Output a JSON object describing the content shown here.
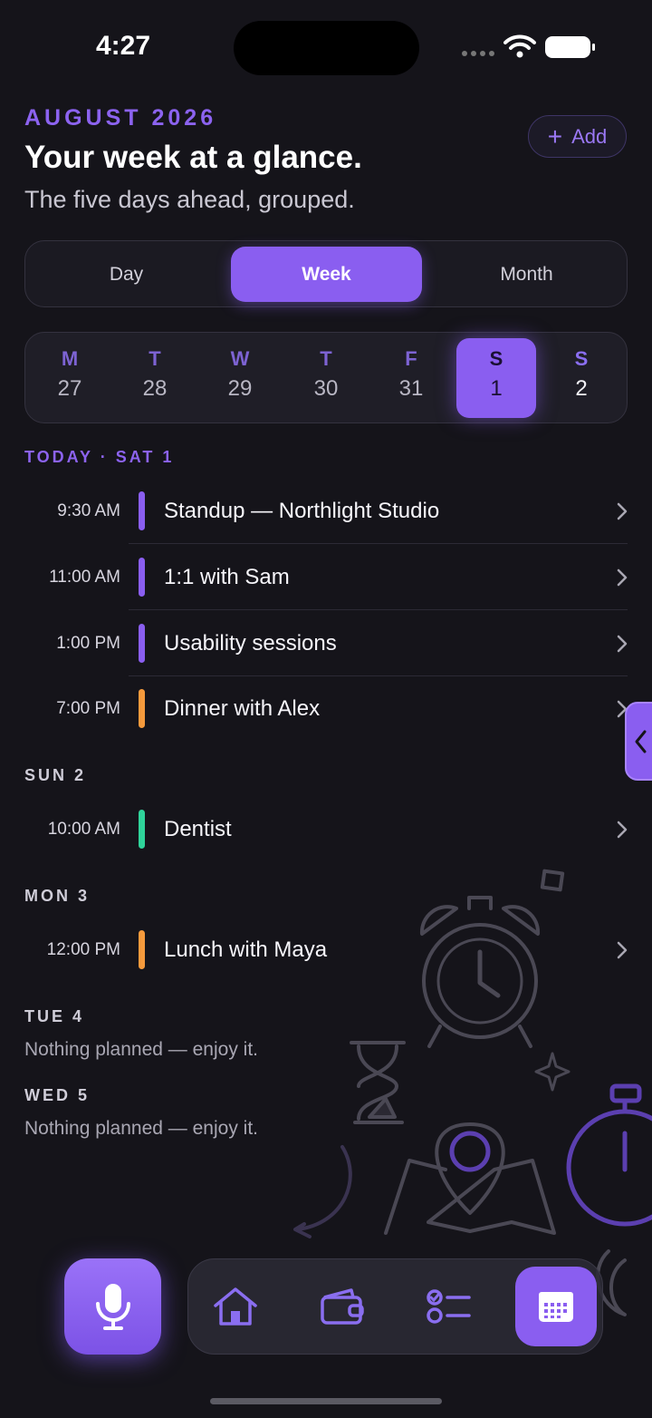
{
  "status": {
    "time": "4:27"
  },
  "header": {
    "month": "AUGUST 2026",
    "title": "Your week at a glance.",
    "subtitle": "The five days ahead, grouped.",
    "add_label": "Add"
  },
  "view_switch": {
    "options": [
      "Day",
      "Week",
      "Month"
    ],
    "selected": "Week"
  },
  "day_strip": [
    {
      "letter": "M",
      "num": "27"
    },
    {
      "letter": "T",
      "num": "28"
    },
    {
      "letter": "W",
      "num": "29"
    },
    {
      "letter": "T",
      "num": "30"
    },
    {
      "letter": "F",
      "num": "31"
    },
    {
      "letter": "S",
      "num": "1",
      "selected": true
    },
    {
      "letter": "S",
      "num": "2"
    }
  ],
  "sections": {
    "today": {
      "label": "TODAY · SAT 1",
      "events": [
        {
          "time": "9:30 AM",
          "title": "Standup — Northlight Studio",
          "color": "#8a5ef0"
        },
        {
          "time": "11:00 AM",
          "title": "1:1 with Sam",
          "color": "#8a5ef0"
        },
        {
          "time": "1:00 PM",
          "title": "Usability sessions",
          "color": "#8a5ef0"
        },
        {
          "time": "7:00 PM",
          "title": "Dinner with Alex",
          "color": "#f59a3c"
        }
      ]
    },
    "sun": {
      "label": "SUN 2",
      "events": [
        {
          "time": "10:00 AM",
          "title": "Dentist",
          "color": "#2fd39a"
        }
      ]
    },
    "mon": {
      "label": "MON 3",
      "events": [
        {
          "time": "12:00 PM",
          "title": "Lunch with Maya",
          "color": "#f59a3c"
        }
      ]
    },
    "tue": {
      "label": "TUE 4",
      "note": "Nothing planned — enjoy it."
    },
    "wed": {
      "label": "WED 5",
      "note": "Nothing planned — enjoy it."
    }
  },
  "nav": {
    "mic_icon": "microphone-icon",
    "tabs": [
      "home-icon",
      "wallet-icon",
      "checklist-icon",
      "calendar-icon"
    ],
    "active_tab": "calendar-icon"
  },
  "colors": {
    "accent": "#8a5ef0",
    "background": "#15141a",
    "orange": "#f59a3c",
    "green": "#2fd39a"
  }
}
